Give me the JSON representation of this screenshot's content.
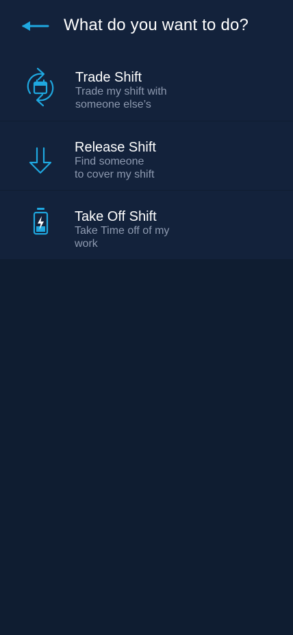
{
  "header": {
    "title": "What do you want to do?",
    "back_icon": "arrow-left-icon"
  },
  "colors": {
    "accent": "#1fa8e0",
    "background": "#0f1d31",
    "card": "#13223b",
    "text_primary": "#ffffff",
    "text_secondary": "#8e9ab0"
  },
  "options": [
    {
      "label": "Trade Shift",
      "description": "Trade my shift with\nsomeone else’s",
      "icon": "swap-calendar-icon"
    },
    {
      "label": "Release Shift",
      "description": "Find someone\nto cover my shift",
      "icon": "arrow-down-icon"
    },
    {
      "label": "Take Off Shift",
      "description": "Take Time off of my\nwork",
      "icon": "battery-charging-icon"
    }
  ]
}
